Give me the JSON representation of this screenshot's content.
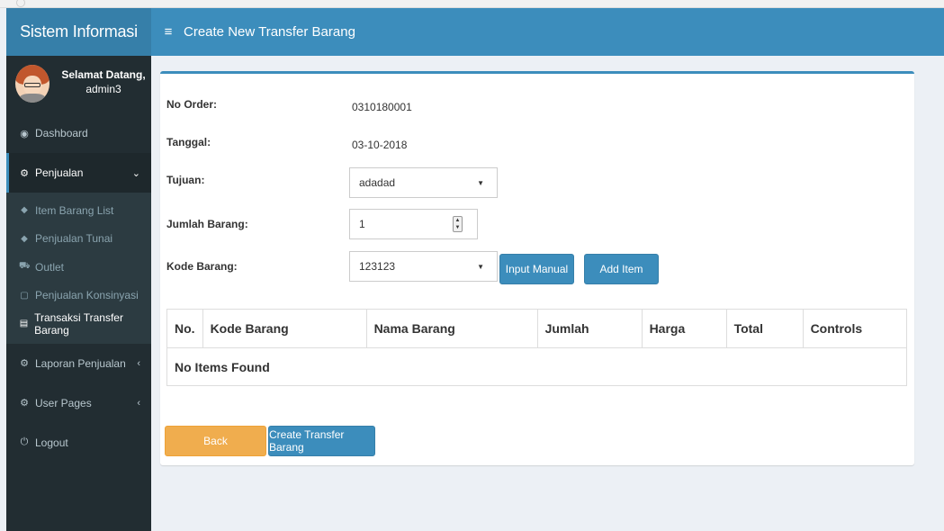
{
  "sidebar": {
    "brand": "Sistem Informasi",
    "user": {
      "greeting": "Selamat Datang,",
      "name": "admin3"
    },
    "items": [
      {
        "label": "Dashboard",
        "icon": "dashboard-icon"
      },
      {
        "label": "Penjualan",
        "icon": "cogs-icon",
        "caret": "⌄"
      },
      {
        "label": "Laporan Penjualan",
        "icon": "cogs-icon",
        "caret": "‹"
      },
      {
        "label": "User Pages",
        "icon": "cogs-icon",
        "caret": "‹"
      },
      {
        "label": "Logout",
        "icon": "power-icon"
      }
    ],
    "submenu": [
      {
        "label": "Item Barang List",
        "icon": "tag-icon"
      },
      {
        "label": "Penjualan Tunai",
        "icon": "tag-icon"
      },
      {
        "label": "Outlet",
        "icon": "cart-icon"
      },
      {
        "label": "Penjualan Konsinyasi",
        "icon": "file-icon"
      },
      {
        "label": "Transaksi Transfer Barang",
        "icon": "list-icon"
      }
    ]
  },
  "header": {
    "menu_icon": "≡",
    "title": "Create New Transfer Barang"
  },
  "form": {
    "no_order": {
      "label": "No Order:",
      "value": "0310180001"
    },
    "tanggal": {
      "label": "Tanggal:",
      "value": "03-10-2018"
    },
    "tujuan": {
      "label": "Tujuan:",
      "value": "adadad"
    },
    "jumlah": {
      "label": "Jumlah Barang:",
      "value": "1"
    },
    "kode": {
      "label": "Kode Barang:",
      "value": "123123"
    },
    "input_manual_label": "Input Manual",
    "add_item_label": "Add Item"
  },
  "table": {
    "headers": [
      "No.",
      "Kode Barang",
      "Nama Barang",
      "Jumlah",
      "Harga",
      "Total",
      "Controls"
    ],
    "empty_text": "No Items Found"
  },
  "actions": {
    "back_label": "Back",
    "create_label": "Create Transfer Barang"
  },
  "colors": {
    "primary": "#3c8dbc",
    "warning": "#f0ad4e",
    "sidebar": "#222d32"
  }
}
